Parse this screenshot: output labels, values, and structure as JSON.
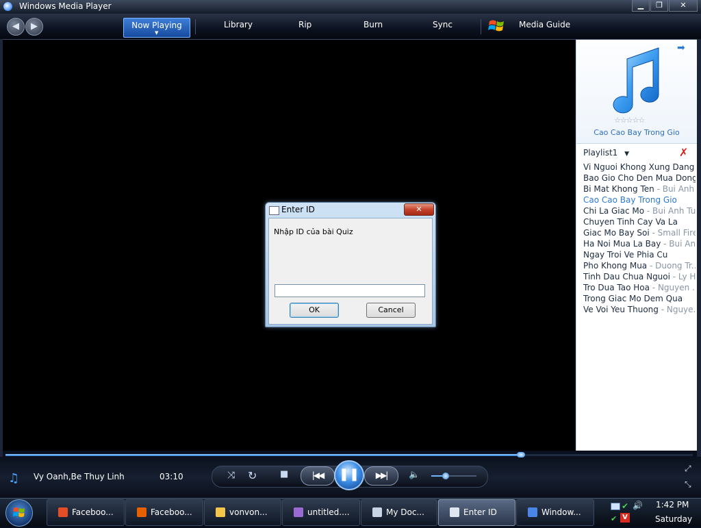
{
  "window": {
    "title": "Windows Media Player",
    "minimize_label": "▁",
    "maximize_label": "❐",
    "close_label": "✕"
  },
  "nav": {
    "back_icon": "back-arrow-icon",
    "forward_icon": "forward-arrow-icon",
    "tabs": [
      "Now Playing",
      "Library",
      "Rip",
      "Burn",
      "Sync",
      "Media Guide"
    ],
    "active_tab": "Now Playing"
  },
  "panel": {
    "album_title": "Cao Cao Bay Trong Gio",
    "rating_stars": "☆☆☆☆☆",
    "playlist_name": "Playlist1",
    "playlist": [
      {
        "title": "Vi Nguoi Khong Xung Dang",
        "artist": ""
      },
      {
        "title": "Bao Gio Cho Den Mua Dong",
        "artist": ""
      },
      {
        "title": "Bi Mat Khong Ten",
        "artist": " - Bui Anh ..."
      },
      {
        "title": "Cao Cao Bay Trong Gio",
        "artist": ""
      },
      {
        "title": "Chi La Giac Mo",
        "artist": " - Bui Anh Tu..."
      },
      {
        "title": "Chuyen Tinh Cay Va La",
        "artist": ""
      },
      {
        "title": "Giac Mo Bay Soi",
        "artist": " - Small Fire"
      },
      {
        "title": "Ha Noi Mua La Bay",
        "artist": " - Bui An..."
      },
      {
        "title": "Ngay Troi Ve Phia Cu",
        "artist": ""
      },
      {
        "title": "Pho Khong Mua",
        "artist": " - Duong Tr..."
      },
      {
        "title": "Tinh Dau Chua Nguoi",
        "artist": " - Ly Hai"
      },
      {
        "title": "Tro Dua Tao Hoa",
        "artist": " - Nguyen ..."
      },
      {
        "title": "Trong Giac Mo Dem Qua",
        "artist": ""
      },
      {
        "title": "Ve Voi Yeu Thuong",
        "artist": " - Nguye..."
      }
    ],
    "current_index": 3
  },
  "playback": {
    "artist": "Vy Oanh,Be Thuy Linh",
    "time": "03:10",
    "seek_progress": 0.75,
    "volume_level": 0.3
  },
  "dialog": {
    "title": "Enter ID",
    "prompt": "Nhập ID của bài Quiz",
    "input_value": "",
    "ok_label": "OK",
    "cancel_label": "Cancel",
    "close_label": "✕"
  },
  "taskbar": {
    "tasks": [
      {
        "label": "Faceboo...",
        "icon": "chrome-icon",
        "color": "#e44d26"
      },
      {
        "label": "Faceboo...",
        "icon": "firefox-icon",
        "color": "#e66000"
      },
      {
        "label": "vonvon...",
        "icon": "folder-icon",
        "color": "#f2c54b"
      },
      {
        "label": "untitled....",
        "icon": "paint-icon",
        "color": "#9a6bd3"
      },
      {
        "label": "My Doc...",
        "icon": "document-icon",
        "color": "#c8d4e4"
      },
      {
        "label": "Enter ID",
        "icon": "window-icon",
        "color": "#dfe6ef"
      },
      {
        "label": "Window...",
        "icon": "media-player-icon",
        "color": "#4a86e8"
      }
    ],
    "active_task": 5,
    "clock_time": "1:42 PM",
    "clock_day": "Saturday"
  },
  "colors": {
    "accent": "#2c7ad6",
    "background": "#000000",
    "close_red": "#c5442b"
  }
}
